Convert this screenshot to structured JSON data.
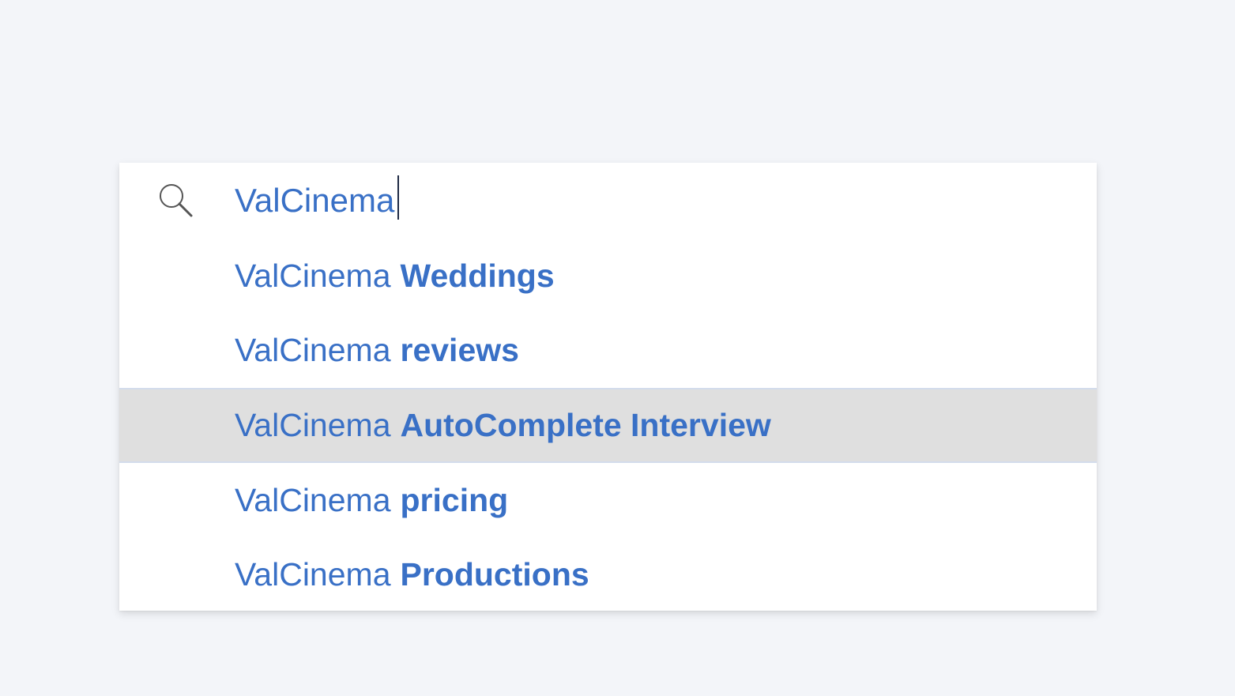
{
  "search": {
    "value": "ValCinema",
    "placeholder": ""
  },
  "icons": {
    "search": "search-icon"
  },
  "colors": {
    "background": "#f3f5f9",
    "text": "#3970c6",
    "highlight": "#dfdfdf",
    "caret": "#1f2a44"
  },
  "suggestions": [
    {
      "prefix": "ValCinema",
      "suffix": "Weddings",
      "active": false
    },
    {
      "prefix": "ValCinema",
      "suffix": "reviews",
      "active": false
    },
    {
      "prefix": "ValCinema",
      "suffix": "AutoComplete Interview",
      "active": true
    },
    {
      "prefix": "ValCinema",
      "suffix": "pricing",
      "active": false
    },
    {
      "prefix": "ValCinema",
      "suffix": "Productions",
      "active": false
    }
  ]
}
